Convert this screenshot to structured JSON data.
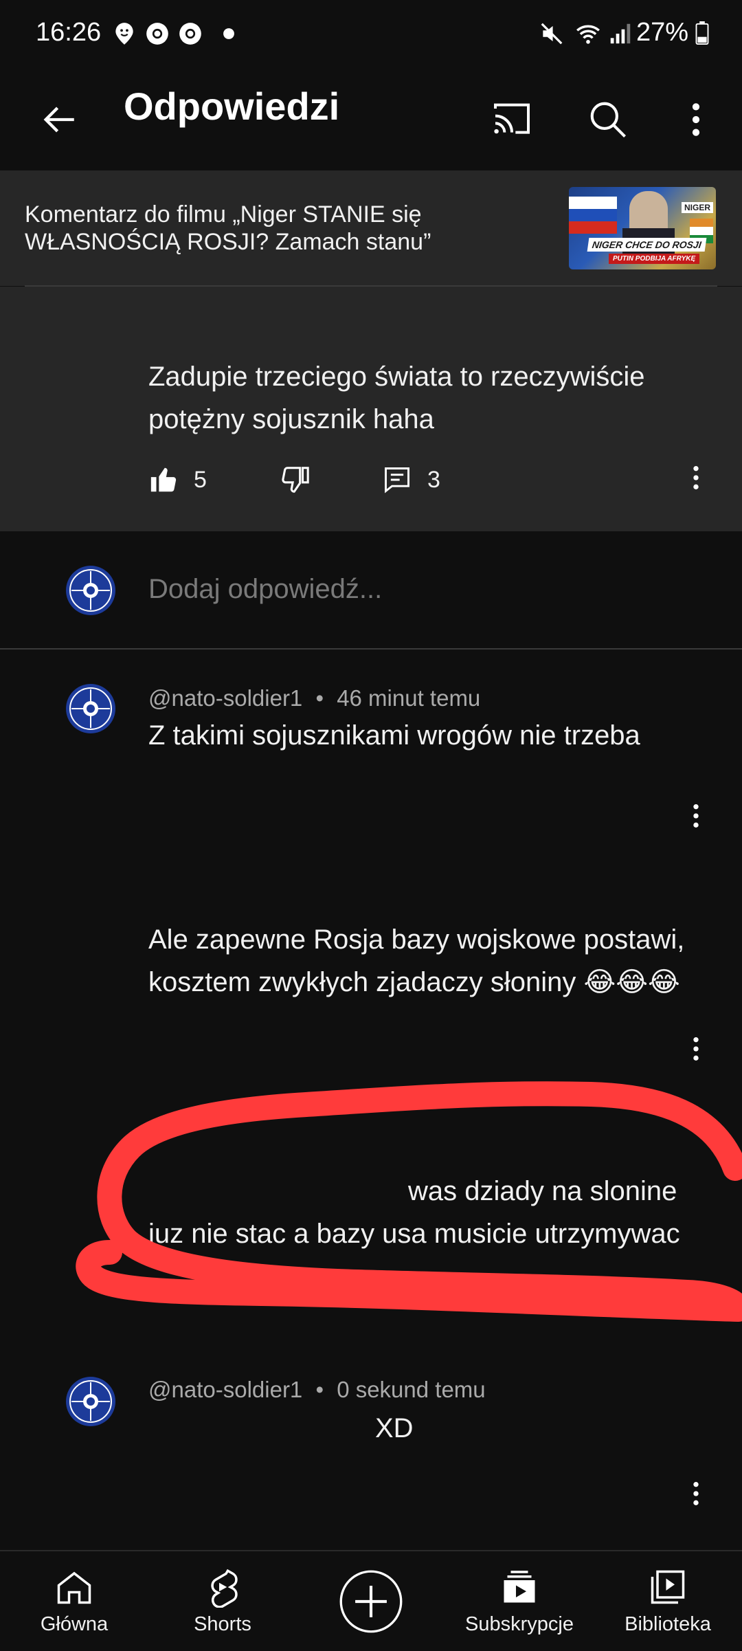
{
  "status_bar": {
    "time": "16:26",
    "battery": "27%",
    "icons": [
      "location-face-icon",
      "chrome-icon",
      "chrome-icon",
      "dot-icon",
      "mute-icon",
      "wifi-icon",
      "signal-icon",
      "battery-icon"
    ]
  },
  "app_bar": {
    "title": "Odpowiedzi",
    "icons": [
      "back-arrow-icon",
      "cast-icon",
      "search-icon",
      "more-vert-icon"
    ]
  },
  "video": {
    "caption": "Komentarz do filmu „Niger STANIE się WŁASNOŚCIĄ ROSJI? Zamach stanu”",
    "thumbnail_tag": "NIGER",
    "thumbnail_caption": "NIGER CHCE DO ROSJI",
    "thumbnail_subcaption": "PUTIN PODBIJA AFRYKĘ"
  },
  "main_comment": {
    "text": "Zadupie trzeciego świata to rzeczywiście potężny sojusznik haha",
    "likes": "5",
    "replies": "3"
  },
  "add_reply": {
    "placeholder": "Dodaj odpowiedź..."
  },
  "replies": [
    {
      "author": "@nato-soldier1",
      "time": "46 minut temu",
      "text": "Z takimi sojusznikami wrogów nie trzeba"
    },
    {
      "text": "Ale zapewne Rosja bazy wojskowe postawi, kosztem zwykłych zjadaczy słoniny 😂😂😂"
    },
    {
      "line1": "was dziady na slonine",
      "line2": "juz nie stac a bazy usa musicie utrzymywac"
    },
    {
      "author": "@nato-soldier1",
      "time": "0 sekund temu",
      "text": "XD"
    }
  ],
  "bottom_nav": [
    {
      "label": "Główna",
      "icon": "home-icon"
    },
    {
      "label": "Shorts",
      "icon": "shorts-icon"
    },
    {
      "label": "",
      "icon": "create-plus-icon"
    },
    {
      "label": "Subskrypcje",
      "icon": "subscriptions-icon"
    },
    {
      "label": "Biblioteka",
      "icon": "library-icon"
    }
  ],
  "colors": {
    "background": "#0f0f0f",
    "surface": "#272727",
    "text": "#f1f1f1",
    "secondary_text": "#aaaaaa",
    "marker": "#ff3b3b",
    "avatar": "#1d3b9a"
  }
}
